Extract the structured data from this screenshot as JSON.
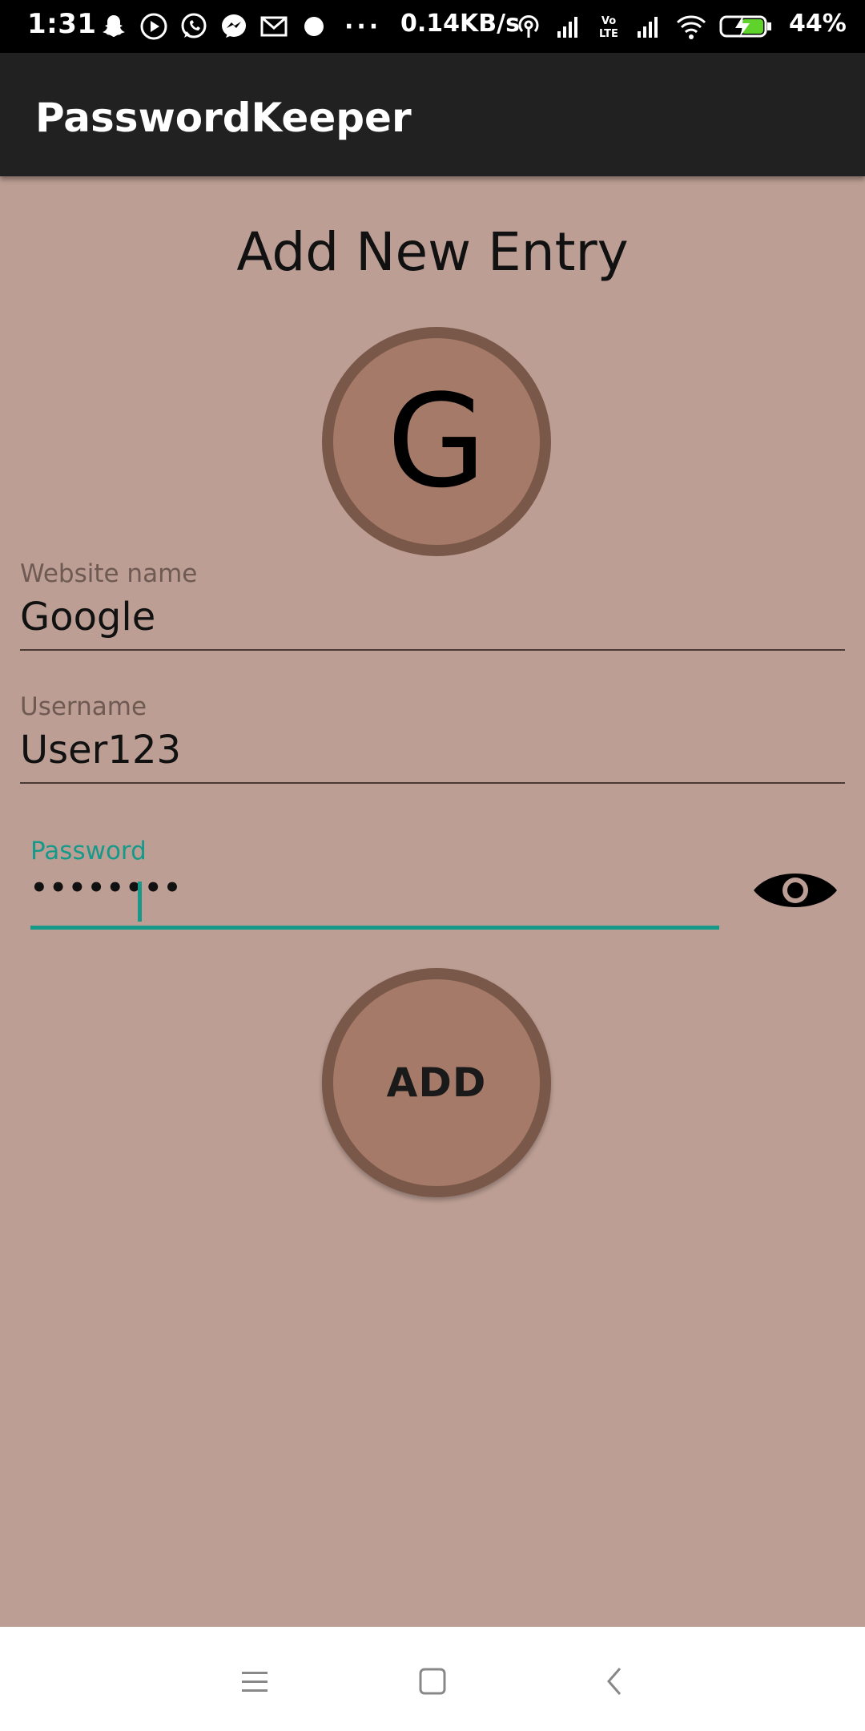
{
  "status_bar": {
    "time": "1:31",
    "net_speed": "0.14KB/s",
    "battery_percent": "44%",
    "icons_left": [
      "snapchat-icon",
      "play-icon",
      "whatsapp-icon",
      "messenger-icon",
      "gmail-icon",
      "dot-icon"
    ],
    "icons_right": [
      "hotspot-icon",
      "signal-icon",
      "volte-icon",
      "signal-icon",
      "wifi-icon",
      "battery-charging-icon"
    ]
  },
  "app_bar": {
    "title": "PasswordKeeper"
  },
  "form": {
    "heading": "Add New Entry",
    "avatar_letter": "G",
    "website": {
      "label": "Website name",
      "value": "Google"
    },
    "username": {
      "label": "Username",
      "value": "User123"
    },
    "password": {
      "label": "Password",
      "value": "••••••••",
      "visibility_icon": "eye-icon"
    },
    "submit_label": "ADD"
  },
  "colors": {
    "background": "#bc9e94",
    "app_bar": "#212121",
    "accent": "#17998a",
    "button_fill": "#a67a69",
    "button_border": "#7a5849"
  },
  "nav_bar": {
    "icons": [
      "menu-icon",
      "home-icon",
      "back-icon"
    ]
  }
}
